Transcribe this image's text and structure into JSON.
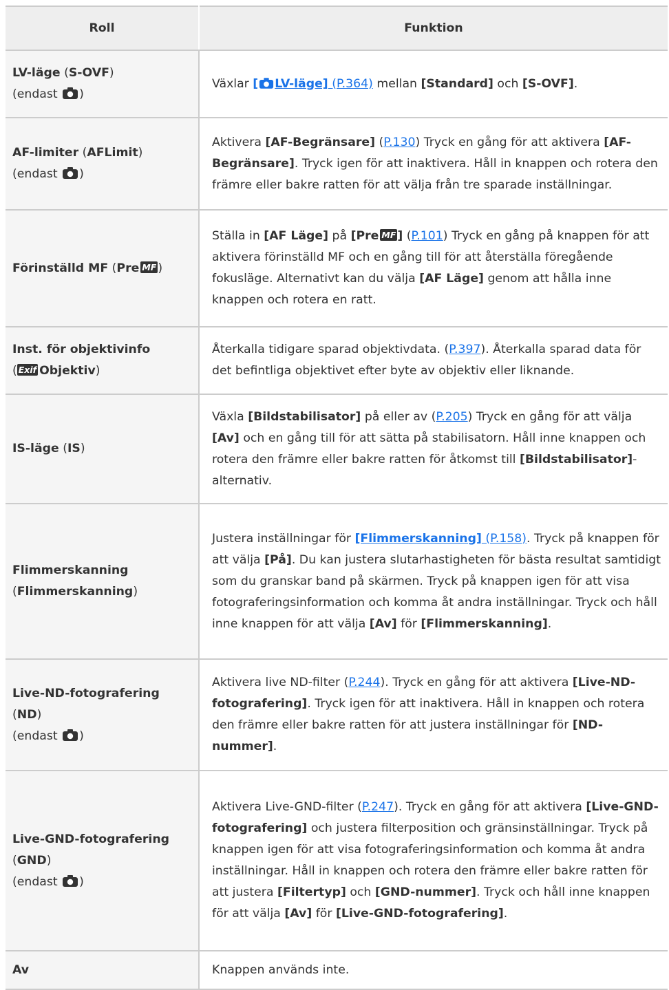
{
  "header": {
    "role": "Roll",
    "function": "Funktion"
  },
  "common": {
    "only_open": "(endast ",
    "only_close": ")",
    "paren_open": "(",
    "paren_close": ")",
    "camera_icon": "camera-icon",
    "mf_badge": "MF",
    "exif_badge": "Exif"
  },
  "rows": [
    {
      "role_name": "LV-läge",
      "role_code": "S-OVF",
      "fn": {
        "t1": "Växlar ",
        "link_open": "[",
        "link_text": "LV-läge]",
        "link_page": " (P.364)",
        "t2": " mellan ",
        "b1": "[Standard]",
        "t3": " och ",
        "b2": "[S-OVF]",
        "t4": "."
      }
    },
    {
      "role_name": "AF-limiter",
      "role_code": "AFLimit",
      "fn": {
        "t1": "Aktivera ",
        "b1": "[AF-Begränsare]",
        "t2": " (",
        "p1": "P.130",
        "t3": ") Tryck en gång för att aktivera ",
        "b2": "[AF-Begränsare]",
        "t4": ". Tryck igen för att inaktivera. Håll in knappen och rotera den främre eller bakre ratten för att välja från tre sparade inställningar."
      }
    },
    {
      "role_name": "Förinställd MF",
      "role_code": "Pre",
      "fn": {
        "t1": "Ställa in ",
        "b1": "[AF Läge]",
        "t2": " på ",
        "b2": "[Pre",
        "b3": "]",
        "t3": " (",
        "p1": "P.101",
        "t4": ") Tryck en gång på knappen för att aktivera förinställd MF och en gång till för att återställa föregående fokusläge. Alternativt kan du välja ",
        "b4": "[AF Läge]",
        "t5": " genom att hålla inne knappen och rotera en ratt."
      }
    },
    {
      "role_name": "Inst. för objektivinfo",
      "role_code": "Objektiv",
      "fn": {
        "t1": "Återkalla tidigare sparad objektivdata. (",
        "p1": "P.397",
        "t2": "). Återkalla sparad data för det befintliga objektivet efter byte av objektiv eller liknande."
      }
    },
    {
      "role_name": "IS-läge",
      "role_code": "IS",
      "fn": {
        "t1": "Växla ",
        "b1": "[Bildstabilisator]",
        "t2": " på eller av (",
        "p1": "P.205",
        "t3": ") Tryck en gång för att välja ",
        "b2": "[Av]",
        "t4": " och en gång till för att sätta på stabilisatorn. Håll inne knappen och rotera den främre eller bakre ratten för åtkomst till ",
        "b3": "[Bildstabilisator]",
        "t5": "-alternativ."
      }
    },
    {
      "role_name": "Flimmerskanning",
      "role_code": "Flimmerskanning",
      "fn": {
        "t1": "Justera inställningar för ",
        "lb1": "[Flimmerskanning]",
        "lp1": " (P.158)",
        "t2": ". Tryck på knappen för att välja ",
        "b1": "[På]",
        "t3": ". Du kan justera slutarhastigheten för bästa resultat samtidigt som du granskar band på skärmen. Tryck på knappen igen för att visa fotograferingsinformation och komma åt andra inställningar. Tryck och håll inne knappen för att välja ",
        "b2": "[Av]",
        "t4": " för ",
        "b3": "[Flimmerskanning]",
        "t5": "."
      }
    },
    {
      "role_name": "Live-ND-fotografering",
      "role_code": "ND",
      "fn": {
        "t1": "Aktivera live ND-filter (",
        "p1": "P.244",
        "t2": "). Tryck en gång för att aktivera ",
        "b1": "[Live-ND-fotografering]",
        "t3": ". Tryck igen för att inaktivera. Håll in knappen och rotera den främre eller bakre ratten för att justera inställningar för ",
        "b2": "[ND-nummer]",
        "t4": "."
      }
    },
    {
      "role_name": "Live-GND-fotografering",
      "role_code": "GND",
      "fn": {
        "t1": "Aktivera Live-GND-filter (",
        "p1": "P.247",
        "t2": "). Tryck en gång för att aktivera ",
        "b1": "[Live-GND-fotografering]",
        "t3": " och justera filterposition och gränsinställningar. Tryck på knappen igen för att visa fotograferingsinformation och komma åt andra inställningar. Håll in knappen och rotera den främre eller bakre ratten för att justera ",
        "b2": "[Filtertyp]",
        "t4": " och ",
        "b3": "[GND-nummer]",
        "t5": ". Tryck och håll inne knappen för att välja ",
        "b4": "[Av]",
        "t6": " för ",
        "b5": "[Live-GND-fotografering]",
        "t7": "."
      }
    },
    {
      "role_name": "Av",
      "fn": {
        "t1": "Knappen används inte."
      }
    }
  ]
}
